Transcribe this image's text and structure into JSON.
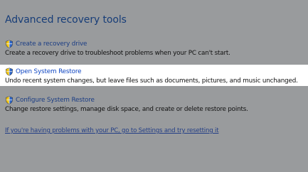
{
  "section": {
    "title": "Advanced recovery tools"
  },
  "tools": [
    {
      "link_label": "Create a recovery drive",
      "description": "Create a recovery drive to troubleshoot problems when your PC can't start.",
      "icon": "shield-icon",
      "selected": false
    },
    {
      "link_label": "Open System Restore",
      "description": "Undo recent system changes, but leave files such as documents, pictures, and music unchanged.",
      "icon": "shield-icon",
      "selected": true
    },
    {
      "link_label": "Configure System Restore",
      "description": "Change restore settings, manage disk space, and create or delete restore points.",
      "icon": "shield-icon",
      "selected": false
    }
  ],
  "footer": {
    "reset_link": "If you're having problems with your PC, go to Settings and try resetting it"
  },
  "colors": {
    "background": "#999b9d",
    "selected_row": "#ffffff",
    "title_text": "#173d78",
    "link_text": "#1b3d84",
    "selected_link_text": "#0c43c1",
    "description_text": "#111111"
  }
}
